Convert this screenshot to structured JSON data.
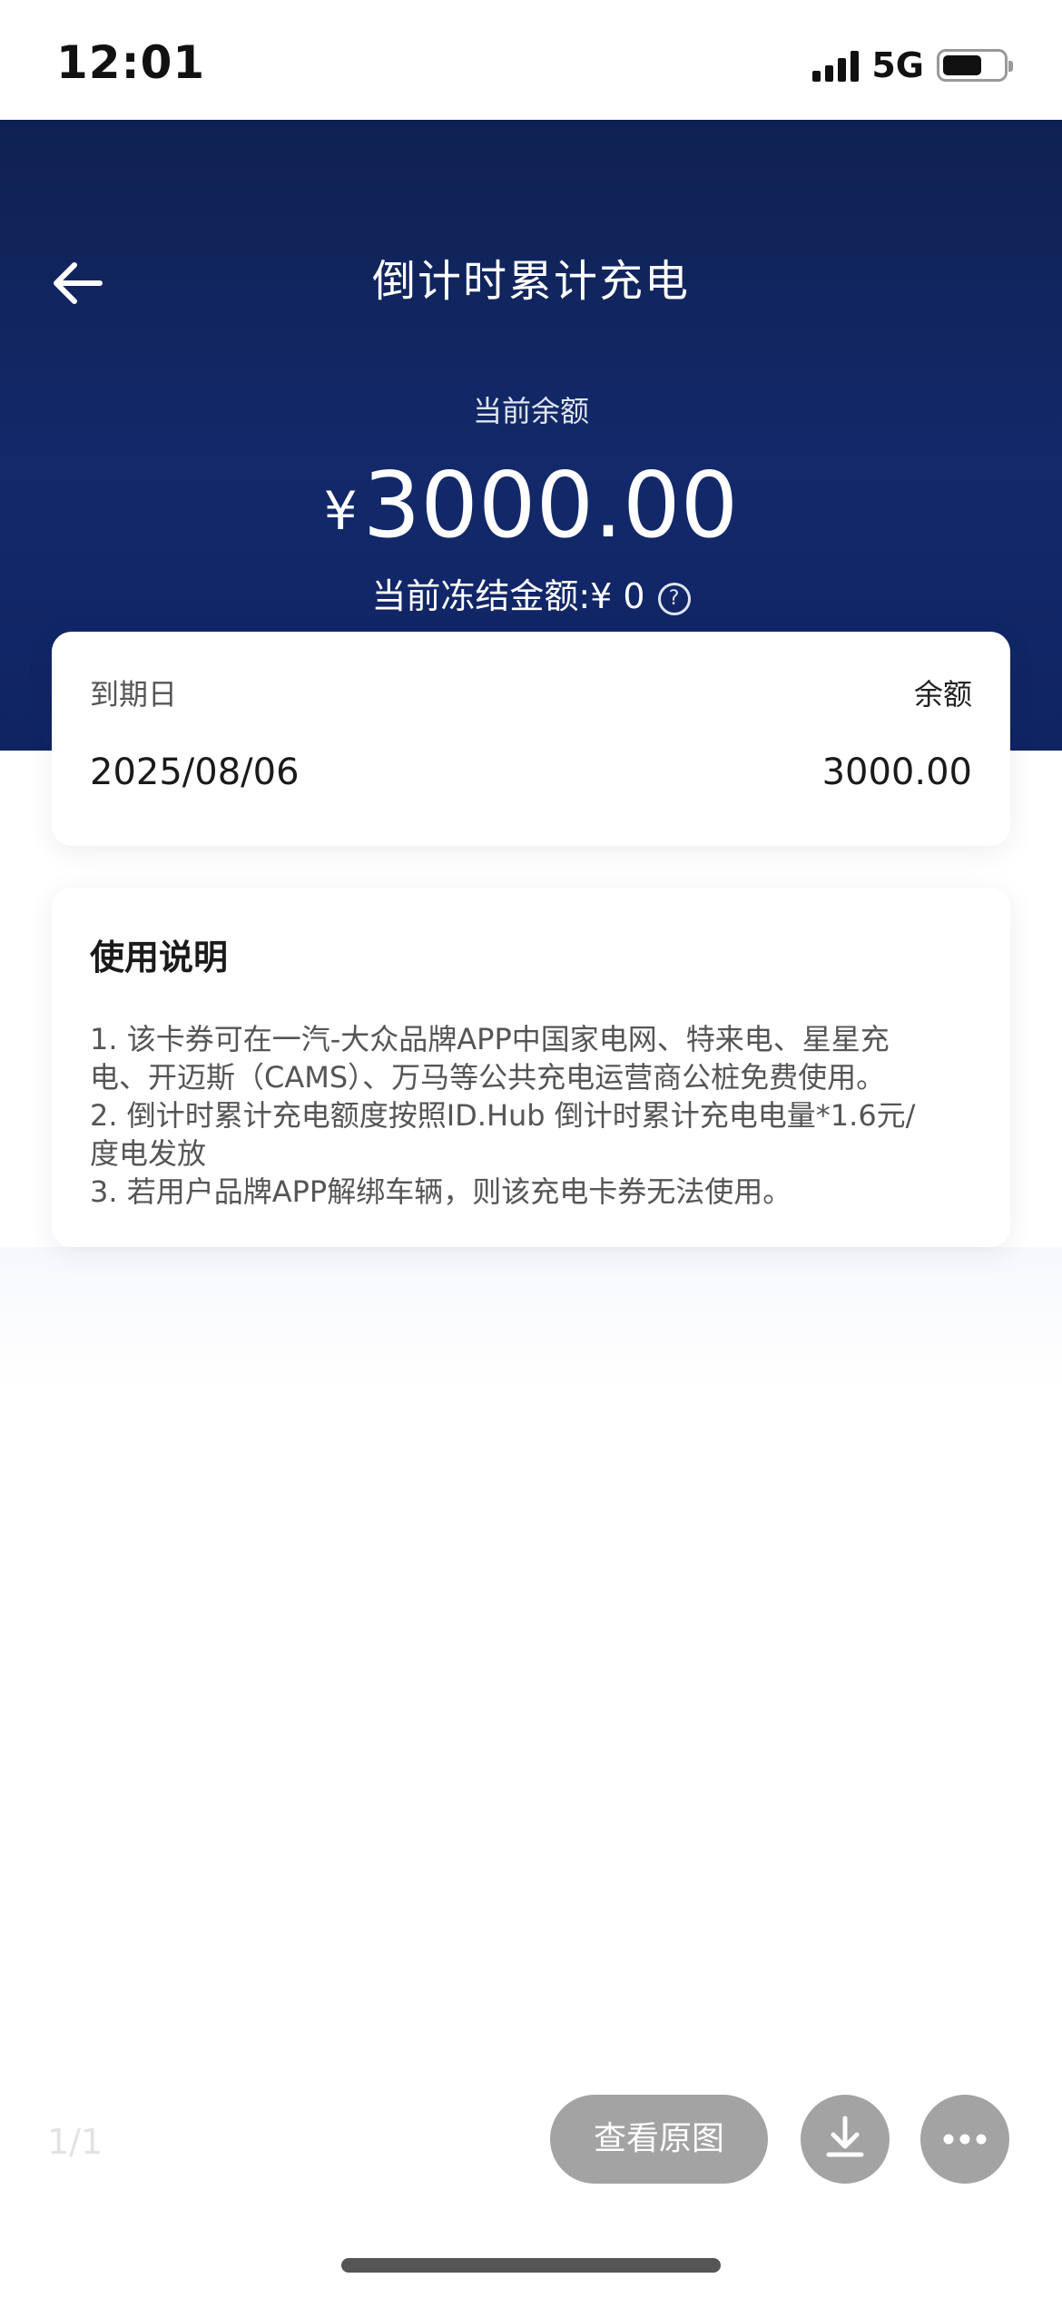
{
  "status_bar": {
    "time": "12:01",
    "network": "5G",
    "icons": [
      "signal-icon",
      "battery-icon"
    ]
  },
  "header": {
    "title": "倒计时累计充电",
    "back_icon": "arrow-left-icon"
  },
  "balance": {
    "label": "当前余额",
    "currency_symbol": "¥",
    "amount": "3000.00",
    "frozen_text": "当前冻结金额:¥ 0",
    "help_icon_glyph": "?"
  },
  "expiry_card": {
    "expiry_label": "到期日",
    "balance_label": "余额",
    "expiry_date": "2025/08/06",
    "balance_value": "3000.00"
  },
  "notes": {
    "title": "使用说明",
    "lines": [
      "1. 该卡券可在一汽-大众品牌APP中国家电网、特来电、星星充",
      "电、开迈斯（CAMS）、万马等公共充电运营商公桩免费使用。",
      "2. 倒计时累计充电额度按照ID.Hub 倒计时累计充电电量*1.6元/",
      "度电发放",
      "3. 若用户品牌APP解绑车辆，则该充电卡券无法使用。"
    ]
  },
  "viewer": {
    "page_indicator": "1/1",
    "view_original_label": "查看原图",
    "download_icon": "download-icon",
    "more_icon": "more-icon"
  },
  "colors": {
    "hero_background": "#13296a",
    "viewer_button": "#a3a3a3"
  }
}
